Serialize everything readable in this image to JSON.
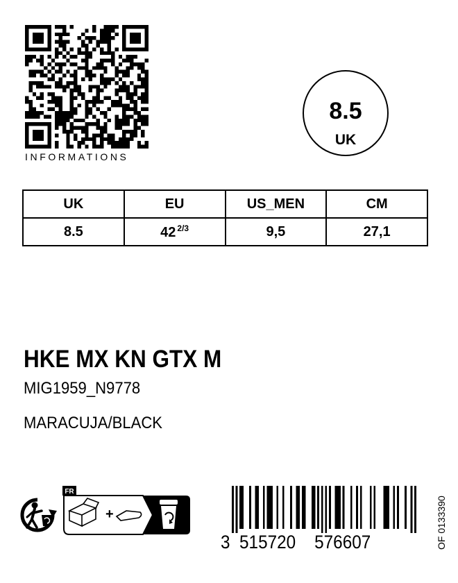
{
  "qr": {
    "caption": "INFORMATIONS"
  },
  "size_badge": {
    "size": "8.5",
    "unit": "UK"
  },
  "size_table": {
    "headers": [
      "UK",
      "EU",
      "US_MEN",
      "CM"
    ],
    "values": {
      "uk": "8.5",
      "eu_whole": "42",
      "eu_fraction": "2/3",
      "us_men": "9,5",
      "cm": "27,1"
    }
  },
  "product": {
    "model": "HKE MX KN GTX M",
    "article": "MIG1959_N9778",
    "color": "MARACUJA/BLACK"
  },
  "recycling": {
    "country": "FR"
  },
  "barcode": {
    "first_digit": "3",
    "left_group": "515720",
    "right_group": "576607",
    "vertical_code": "OF 0133390"
  }
}
